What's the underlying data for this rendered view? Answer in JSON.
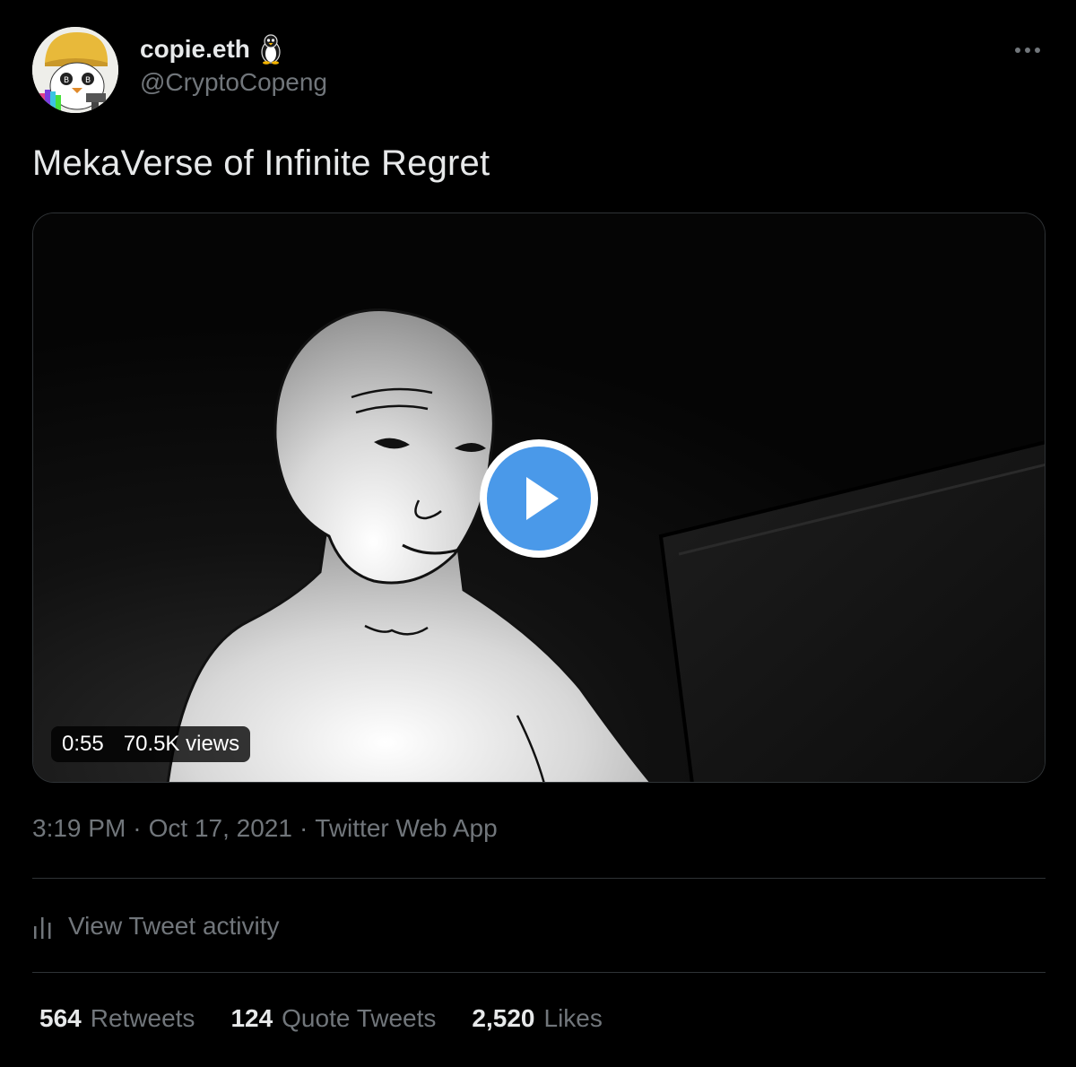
{
  "author": {
    "display_name": "copie.eth",
    "name_emoji_icon": "penguin-icon",
    "handle": "@CryptoCopeng"
  },
  "tweet": {
    "text": "MekaVerse of Infinite Regret"
  },
  "video": {
    "duration": "0:55",
    "views": "70.5K views",
    "play_icon": "play-icon"
  },
  "meta": {
    "time": "3:19 PM",
    "separator": "·",
    "date": "Oct 17, 2021",
    "source": "Twitter Web App"
  },
  "activity": {
    "label": "View Tweet activity",
    "icon": "bar-chart-icon"
  },
  "stats": [
    {
      "count": "564",
      "label": "Retweets"
    },
    {
      "count": "124",
      "label": "Quote Tweets"
    },
    {
      "count": "2,520",
      "label": "Likes"
    }
  ],
  "colors": {
    "background": "#000000",
    "primary_text": "#e7e9ea",
    "secondary_text": "#71767b",
    "divider": "#2f3336",
    "play_blue": "#4a99e9"
  }
}
